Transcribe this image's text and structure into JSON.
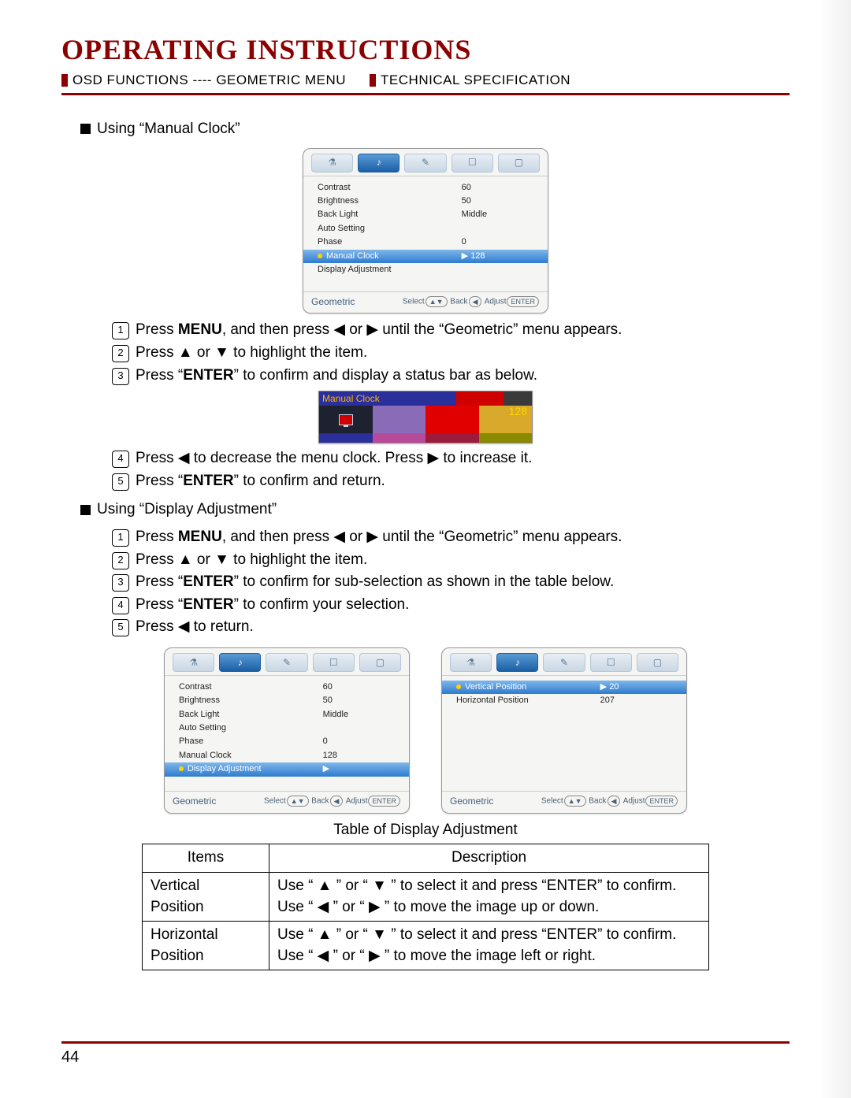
{
  "page": {
    "title": "OPERATING INSTRUCTIONS",
    "sub1": "OSD FUNCTIONS ---- GEOMETRIC MENU",
    "sub2": "TECHNICAL SPECIFICATION",
    "number": "44"
  },
  "section1": {
    "heading": "Using “Manual Clock”",
    "steps": [
      {
        "n": "1",
        "pre": "Press ",
        "b": "MENU",
        "post": ", and then press ◀ or ▶ until the “Geometric” menu appears."
      },
      {
        "n": "2",
        "pre": "Press ▲ or ▼ to highlight the item.",
        "b": "",
        "post": ""
      },
      {
        "n": "3",
        "pre": "Press “",
        "b": "ENTER",
        "post": "” to confirm and display a status bar as below."
      },
      {
        "n": "4",
        "pre": "Press ◀  to decrease the menu clock. Press ▶ to increase it.",
        "b": "",
        "post": ""
      },
      {
        "n": "5",
        "pre": "Press “",
        "b": "ENTER",
        "post": "” to confirm and return."
      }
    ]
  },
  "section2": {
    "heading": "Using “Display Adjustment”",
    "steps": [
      {
        "n": "1",
        "pre": "Press ",
        "b": "MENU",
        "post": ", and then press ◀ or ▶ until the “Geometric” menu appears."
      },
      {
        "n": "2",
        "pre": "Press ▲ or ▼ to highlight the item.",
        "b": "",
        "post": ""
      },
      {
        "n": "3",
        "pre": "Press “",
        "b": "ENTER",
        "post": "” to confirm for sub-selection as shown in the table below."
      },
      {
        "n": "4",
        "pre": "Press “",
        "b": "ENTER",
        "post": "” to confirm your selection."
      },
      {
        "n": "5",
        "pre": "Press ◀  to return.",
        "b": "",
        "post": ""
      }
    ]
  },
  "osd_common": {
    "footer_label": "Geometric",
    "footer_hints": {
      "select": "Select",
      "back": "Back",
      "adjust": "Adjust",
      "enter": "ENTER",
      "ud": "▲▼",
      "l": "◀"
    },
    "tabs": [
      "⚗",
      "♪",
      "✎",
      "☐",
      "▢"
    ]
  },
  "osd_rows": {
    "contrast": {
      "lbl": "Contrast",
      "val": "60"
    },
    "brightness": {
      "lbl": "Brightness",
      "val": "50"
    },
    "backlight": {
      "lbl": "Back Light",
      "val": "Middle"
    },
    "autosetting": {
      "lbl": "Auto Setting",
      "val": ""
    },
    "phase": {
      "lbl": "Phase",
      "val": "0"
    },
    "manualclock": {
      "lbl": "Manual Clock",
      "val": "128",
      "sel_val": "▶  128"
    },
    "displayadj": {
      "lbl": "Display Adjustment",
      "val": "",
      "sel_val": "▶"
    }
  },
  "osd3_rows": {
    "vpos": {
      "lbl": "Vertical Position",
      "val": "▶  20"
    },
    "hpos": {
      "lbl": "Horizontal Position",
      "val": "207"
    }
  },
  "statusbar": {
    "label": "Manual Clock",
    "value": "128"
  },
  "table": {
    "title": "Table of Display Adjustment",
    "head": {
      "c1": "Items",
      "c2": "Description"
    },
    "rows": [
      {
        "item": "Vertical Position",
        "d1": "Use “ ▲ ” or “ ▼ ” to select it and press “ENTER” to confirm.",
        "d2": "Use “ ◀ ” or “ ▶ ” to move the image up or down."
      },
      {
        "item": "Horizontal Position",
        "d1": "Use “ ▲ ” or “ ▼ ” to select it and press “ENTER” to confirm.",
        "d2": "Use “ ◀ ” or “ ▶ ” to move the image left or right."
      }
    ]
  }
}
